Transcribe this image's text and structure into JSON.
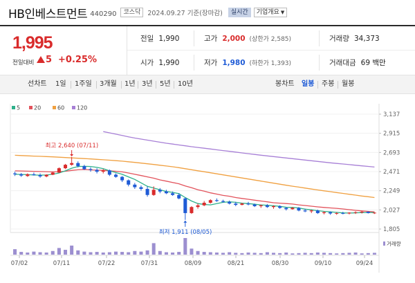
{
  "header": {
    "stock_name": "HB인베스트먼트",
    "stock_code": "440290",
    "market": "코스닥",
    "date": "2024.09.27 기준(장마감)",
    "realtime_label": "실시간",
    "company_info_label": "기업개요",
    "chevron_icon": "chevron-down-icon"
  },
  "price": {
    "current": "1,995",
    "change_label": "전일대비",
    "change_amount": "5",
    "change_rate": "+0.25%",
    "direction": "up",
    "up_color": "#d92b2b",
    "down_color": "#1f5bd6"
  },
  "stats": {
    "prev_close": {
      "label": "전일",
      "value": "1,990"
    },
    "high": {
      "label": "고가",
      "value": "2,000",
      "sub": "(상한가 2,585)"
    },
    "volume": {
      "label": "거래량",
      "value": "34,373"
    },
    "open": {
      "label": "시가",
      "value": "1,990"
    },
    "low": {
      "label": "저가",
      "value": "1,980",
      "sub": "(하한가 1,393)"
    },
    "amount": {
      "label": "거래대금",
      "value": "69 백만"
    }
  },
  "toolbar": {
    "line_chart_label": "선차트",
    "periods": [
      "1일",
      "1주일",
      "3개월",
      "1년",
      "3년",
      "5년",
      "10년"
    ],
    "candle_chart_label": "봉차트",
    "candle_periods": [
      "일봉",
      "주봉",
      "월봉"
    ],
    "active_candle_period": "일봉"
  },
  "chart_data": {
    "type": "candlestick",
    "legend": [
      {
        "name": "5",
        "color": "#2db08a"
      },
      {
        "name": "20",
        "color": "#e2525b"
      },
      {
        "name": "60",
        "color": "#f0a040"
      },
      {
        "name": "120",
        "color": "#a77fd6"
      }
    ],
    "y_ticks": [
      "3,137",
      "2,915",
      "2,693",
      "2,471",
      "2,249",
      "2,027",
      "1,805"
    ],
    "ylim": [
      1805,
      3137
    ],
    "x_ticks": [
      "07/02",
      "07/11",
      "07/22",
      "07/31",
      "08/09",
      "08/21",
      "08/30",
      "09/10",
      "09/24"
    ],
    "volume_label": "거래량",
    "annotations": {
      "high": "최고 2,640 (07/11)",
      "low": "최저 1,911 (08/05)"
    },
    "candles": [
      {
        "o": 2450,
        "h": 2470,
        "l": 2420,
        "c": 2440
      },
      {
        "o": 2440,
        "h": 2455,
        "l": 2410,
        "c": 2425
      },
      {
        "o": 2420,
        "h": 2450,
        "l": 2410,
        "c": 2440
      },
      {
        "o": 2440,
        "h": 2460,
        "l": 2425,
        "c": 2430
      },
      {
        "o": 2430,
        "h": 2450,
        "l": 2400,
        "c": 2415
      },
      {
        "o": 2415,
        "h": 2440,
        "l": 2405,
        "c": 2435
      },
      {
        "o": 2435,
        "h": 2470,
        "l": 2430,
        "c": 2460
      },
      {
        "o": 2460,
        "h": 2520,
        "l": 2455,
        "c": 2510
      },
      {
        "o": 2510,
        "h": 2560,
        "l": 2500,
        "c": 2550
      },
      {
        "o": 2550,
        "h": 2640,
        "l": 2540,
        "c": 2570
      },
      {
        "o": 2570,
        "h": 2590,
        "l": 2520,
        "c": 2535
      },
      {
        "o": 2535,
        "h": 2550,
        "l": 2490,
        "c": 2500
      },
      {
        "o": 2500,
        "h": 2520,
        "l": 2470,
        "c": 2490
      },
      {
        "o": 2490,
        "h": 2510,
        "l": 2450,
        "c": 2470
      },
      {
        "o": 2470,
        "h": 2500,
        "l": 2450,
        "c": 2485
      },
      {
        "o": 2485,
        "h": 2495,
        "l": 2420,
        "c": 2435
      },
      {
        "o": 2435,
        "h": 2450,
        "l": 2400,
        "c": 2410
      },
      {
        "o": 2410,
        "h": 2420,
        "l": 2350,
        "c": 2370
      },
      {
        "o": 2370,
        "h": 2380,
        "l": 2300,
        "c": 2320
      },
      {
        "o": 2320,
        "h": 2340,
        "l": 2270,
        "c": 2290
      },
      {
        "o": 2290,
        "h": 2310,
        "l": 2250,
        "c": 2270
      },
      {
        "o": 2270,
        "h": 2300,
        "l": 2180,
        "c": 2200
      },
      {
        "o": 2200,
        "h": 2300,
        "l": 2190,
        "c": 2260
      },
      {
        "o": 2260,
        "h": 2280,
        "l": 2220,
        "c": 2240
      },
      {
        "o": 2240,
        "h": 2260,
        "l": 2210,
        "c": 2220
      },
      {
        "o": 2220,
        "h": 2240,
        "l": 2190,
        "c": 2200
      },
      {
        "o": 2200,
        "h": 2220,
        "l": 2150,
        "c": 2160
      },
      {
        "o": 2160,
        "h": 2170,
        "l": 1911,
        "c": 1990
      },
      {
        "o": 1990,
        "h": 2070,
        "l": 1980,
        "c": 2060
      },
      {
        "o": 2060,
        "h": 2100,
        "l": 2040,
        "c": 2080
      },
      {
        "o": 2080,
        "h": 2130,
        "l": 2070,
        "c": 2110
      },
      {
        "o": 2110,
        "h": 2150,
        "l": 2100,
        "c": 2140
      },
      {
        "o": 2140,
        "h": 2160,
        "l": 2120,
        "c": 2130
      },
      {
        "o": 2130,
        "h": 2145,
        "l": 2110,
        "c": 2120
      },
      {
        "o": 2120,
        "h": 2135,
        "l": 2090,
        "c": 2100
      },
      {
        "o": 2100,
        "h": 2120,
        "l": 2070,
        "c": 2085
      },
      {
        "o": 2085,
        "h": 2110,
        "l": 2080,
        "c": 2100
      },
      {
        "o": 2100,
        "h": 2120,
        "l": 2080,
        "c": 2090
      },
      {
        "o": 2090,
        "h": 2100,
        "l": 2060,
        "c": 2070
      },
      {
        "o": 2070,
        "h": 2090,
        "l": 2050,
        "c": 2080
      },
      {
        "o": 2080,
        "h": 2095,
        "l": 2050,
        "c": 2060
      },
      {
        "o": 2060,
        "h": 2080,
        "l": 2040,
        "c": 2070
      },
      {
        "o": 2070,
        "h": 2080,
        "l": 2040,
        "c": 2050
      },
      {
        "o": 2050,
        "h": 2060,
        "l": 2020,
        "c": 2035
      },
      {
        "o": 2035,
        "h": 2060,
        "l": 2030,
        "c": 2050
      },
      {
        "o": 2050,
        "h": 2060,
        "l": 2010,
        "c": 2020
      },
      {
        "o": 2020,
        "h": 2040,
        "l": 2000,
        "c": 2010
      },
      {
        "o": 2010,
        "h": 2030,
        "l": 1990,
        "c": 2020
      },
      {
        "o": 2020,
        "h": 2030,
        "l": 1980,
        "c": 1990
      },
      {
        "o": 1990,
        "h": 2010,
        "l": 1975,
        "c": 2000
      },
      {
        "o": 2000,
        "h": 2010,
        "l": 1970,
        "c": 1985
      },
      {
        "o": 1985,
        "h": 2000,
        "l": 1970,
        "c": 1990
      },
      {
        "o": 1990,
        "h": 2005,
        "l": 1975,
        "c": 1985
      },
      {
        "o": 1985,
        "h": 2000,
        "l": 1975,
        "c": 1995
      },
      {
        "o": 1995,
        "h": 2010,
        "l": 1980,
        "c": 2000
      },
      {
        "o": 2000,
        "h": 2015,
        "l": 1985,
        "c": 2005
      },
      {
        "o": 2005,
        "h": 2010,
        "l": 1985,
        "c": 1990
      },
      {
        "o": 1990,
        "h": 2000,
        "l": 1980,
        "c": 1995
      }
    ],
    "ma5": [
      2440,
      2438,
      2436,
      2432,
      2430,
      2432,
      2440,
      2455,
      2480,
      2510,
      2530,
      2532,
      2530,
      2520,
      2505,
      2480,
      2460,
      2440,
      2410,
      2380,
      2340,
      2300,
      2280,
      2260,
      2240,
      2230,
      2215,
      2170,
      2130,
      2100,
      2090,
      2085,
      2100,
      2115,
      2120,
      2115,
      2105,
      2100,
      2092,
      2085,
      2080,
      2075,
      2068,
      2058,
      2055,
      2050,
      2035,
      2028,
      2018,
      2010,
      2004,
      1998,
      1992,
      1990,
      1993,
      1996,
      1997,
      1996
    ],
    "ma20": [
      2480,
      2478,
      2476,
      2474,
      2472,
      2470,
      2468,
      2470,
      2475,
      2485,
      2492,
      2495,
      2490,
      2488,
      2485,
      2480,
      2475,
      2468,
      2455,
      2440,
      2425,
      2410,
      2395,
      2375,
      2360,
      2345,
      2330,
      2305,
      2285,
      2260,
      2245,
      2225,
      2210,
      2195,
      2185,
      2170,
      2160,
      2150,
      2140,
      2130,
      2120,
      2110,
      2105,
      2100,
      2095,
      2085,
      2078,
      2070,
      2062,
      2055,
      2050,
      2045,
      2038,
      2030,
      2022,
      2015,
      2010,
      2005
    ],
    "ma60": [
      2660,
      2657,
      2654,
      2651,
      2648,
      2645,
      2642,
      2638,
      2634,
      2630,
      2626,
      2622,
      2618,
      2613,
      2608,
      2603,
      2598,
      2592,
      2585,
      2578,
      2570,
      2562,
      2554,
      2545,
      2536,
      2527,
      2517,
      2505,
      2493,
      2481,
      2469,
      2457,
      2445,
      2433,
      2421,
      2409,
      2397,
      2385,
      2373,
      2361,
      2349,
      2337,
      2325,
      2313,
      2302,
      2291,
      2280,
      2269,
      2258,
      2248,
      2238,
      2228,
      2218,
      2208,
      2198,
      2188,
      2180,
      2170
    ],
    "ma120": [
      null,
      null,
      null,
      null,
      null,
      null,
      null,
      null,
      null,
      null,
      null,
      null,
      null,
      null,
      2935,
      2920,
      2905,
      2890,
      2875,
      2860,
      2848,
      2836,
      2824,
      2812,
      2800,
      2790,
      2780,
      2770,
      2760,
      2751,
      2742,
      2733,
      2724,
      2715,
      2706,
      2697,
      2688,
      2679,
      2670,
      2661,
      2653,
      2645,
      2637,
      2629,
      2621,
      2613,
      2605,
      2597,
      2589,
      2581,
      2573,
      2566,
      2559,
      2552,
      2545,
      2538,
      2531,
      2524
    ],
    "volumes": [
      18,
      9,
      7,
      10,
      8,
      7,
      12,
      22,
      16,
      30,
      14,
      10,
      8,
      9,
      7,
      8,
      10,
      9,
      8,
      12,
      10,
      14,
      38,
      12,
      8,
      7,
      9,
      55,
      20,
      12,
      9,
      8,
      7,
      6,
      8,
      6,
      5,
      7,
      6,
      5,
      8,
      6,
      5,
      7,
      4,
      5,
      6,
      5,
      7,
      6,
      5,
      4,
      5,
      6,
      7,
      4,
      5,
      6
    ]
  }
}
